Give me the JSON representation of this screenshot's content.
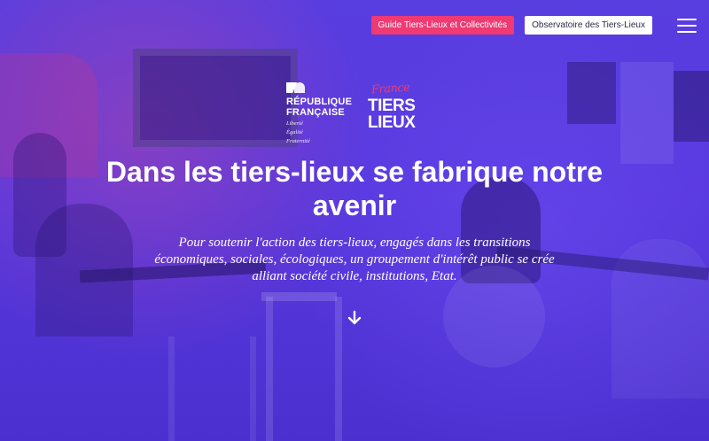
{
  "nav": {
    "guide_button": "Guide Tiers-Lieux et Collectivités",
    "observatoire_button": "Observatoire des Tiers-Lieux",
    "menu_icon": "hamburger-menu-icon"
  },
  "logos": {
    "republique": {
      "line1": "RÉPUBLIQUE",
      "line2": "FRANÇAISE",
      "motto1": "Liberté",
      "motto2": "Égalité",
      "motto3": "Fraternité"
    },
    "france_tiers_lieux": {
      "script": "France",
      "word1": "TIERS",
      "word2": "LIEUX"
    }
  },
  "hero": {
    "title": "Dans les tiers-lieux se fabrique notre avenir",
    "subtitle": "Pour soutenir l'action des tiers-lieux, engagés dans les transitions économiques, sociales, écologiques, un groupement d'intérêt public se crée alliant société civile, institutions, Etat.",
    "scroll_icon": "arrow-down-icon"
  },
  "colors": {
    "accent_pink": "#ef3a73",
    "overlay_purple": "#5a3fe0",
    "text": "#ffffff"
  }
}
